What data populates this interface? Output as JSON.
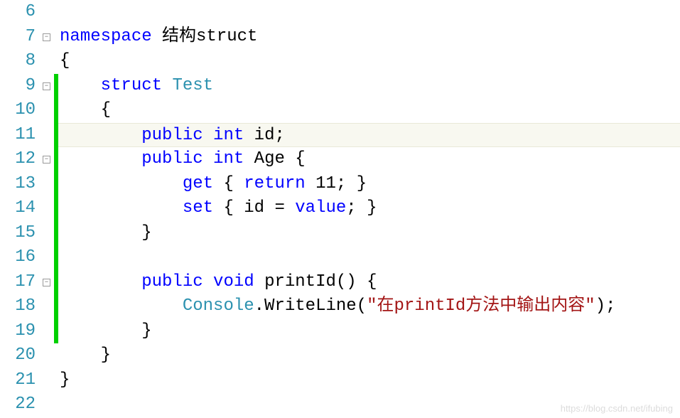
{
  "gutter": {
    "start": 6,
    "end": 22
  },
  "watermark": "https://blog.csdn.net/ifubing",
  "fold_markers": [
    {
      "line": 7,
      "glyph": "⊟"
    },
    {
      "line": 9,
      "glyph": "⊟"
    },
    {
      "line": 12,
      "glyph": "⊟"
    },
    {
      "line": 17,
      "glyph": "⊟"
    }
  ],
  "green_bars": [
    {
      "from": 9,
      "to": 19
    }
  ],
  "highlight_line": 11,
  "code": {
    "l7": {
      "kw_namespace": "namespace",
      "name": "结构struct"
    },
    "l8": {
      "brace": "{"
    },
    "l9": {
      "kw_struct": "struct",
      "type": "Test"
    },
    "l10": {
      "brace": "{"
    },
    "l11": {
      "kw_public": "public",
      "kw_int": "int",
      "id": "id",
      "semi": ";"
    },
    "l12": {
      "kw_public": "public",
      "kw_int": "int",
      "name": "Age",
      "brace": "{"
    },
    "l13": {
      "kw_get": "get",
      "lb": "{",
      "kw_return": "return",
      "val": "11",
      "semi_rb": "; }"
    },
    "l14": {
      "kw_set": "set",
      "lb": "{",
      "id": "id =",
      "kw_value": "value",
      "semi_rb": "; }"
    },
    "l15": {
      "brace": "}"
    },
    "l17": {
      "kw_public": "public",
      "kw_void": "void",
      "name": "printId()",
      "brace": "{"
    },
    "l18": {
      "type": "Console",
      "dot_method": ".WriteLine(",
      "str": "\"在printId方法中输出内容\"",
      "close": ");"
    },
    "l19": {
      "brace": "}"
    },
    "l20": {
      "brace": "}"
    },
    "l21": {
      "brace": "}"
    }
  }
}
